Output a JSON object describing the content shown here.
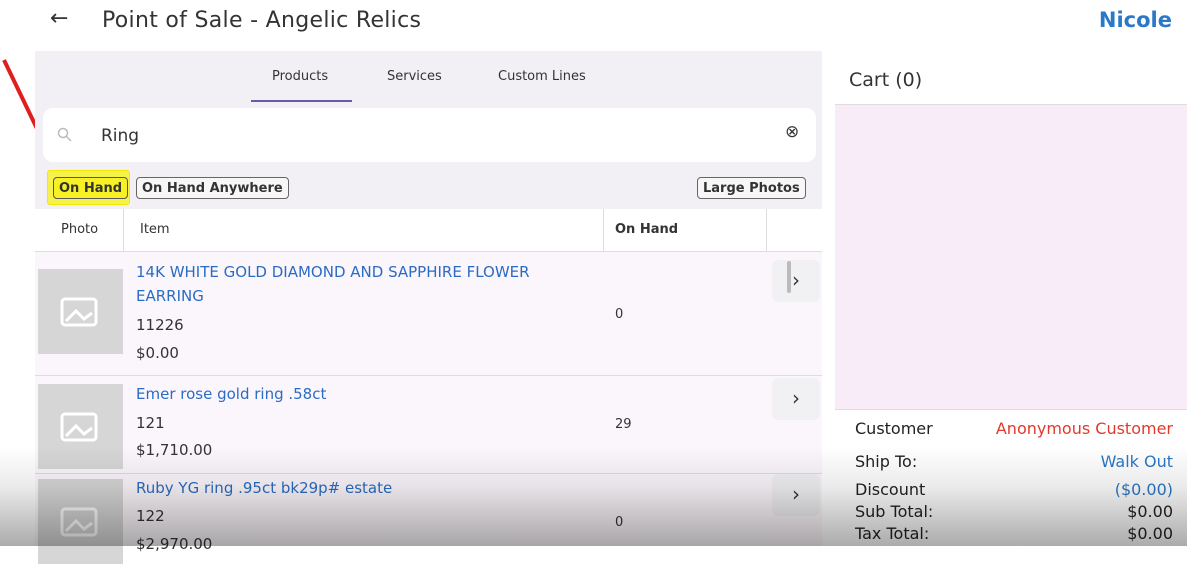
{
  "header": {
    "title": "Point of Sale - Angelic Relics",
    "user": "Nicole",
    "back_icon": "back-arrow-icon"
  },
  "tabs": [
    {
      "label": "Products",
      "active": true
    },
    {
      "label": "Services",
      "active": false
    },
    {
      "label": "Custom Lines",
      "active": false
    }
  ],
  "search": {
    "value": "Ring",
    "icon": "search-icon",
    "clear_icon": "clear-circle-icon"
  },
  "filters": {
    "on_hand": "On Hand",
    "on_hand_active": true,
    "on_hand_anywhere": "On Hand Anywhere",
    "large_photos": "Large Photos"
  },
  "table": {
    "headers": {
      "photo": "Photo",
      "item": "Item",
      "on_hand": "On Hand"
    },
    "rows": [
      {
        "name_line1": "14K WHITE GOLD DIAMOND AND SAPPHIRE FLOWER",
        "name_line2": "EARRING",
        "sku": "11226",
        "price": "$0.00",
        "on_hand": "0"
      },
      {
        "name_line1": "Emer rose gold ring .58ct",
        "sku": "121",
        "price": "$1,710.00",
        "on_hand": "29"
      },
      {
        "name_line1": "Ruby YG ring .95ct bk29p# estate",
        "sku": "122",
        "price": "$2,970.00",
        "on_hand": "0"
      }
    ]
  },
  "cart": {
    "title": "Cart (0)",
    "summary": {
      "customer_label": "Customer",
      "customer_value": "Anonymous Customer",
      "ship_label": "Ship To:",
      "ship_value": "Walk Out",
      "discount_label": "Discount",
      "discount_value": "($0.00)",
      "subtotal_label": "Sub Total:",
      "subtotal_value": "$0.00",
      "tax_label": "Tax Total:",
      "tax_value": "$0.00"
    }
  },
  "colors": {
    "link": "#2a6cc4",
    "highlight": "#f6f024",
    "customer": "#e03a2c",
    "annotation_arrow": "#e01e1e"
  }
}
